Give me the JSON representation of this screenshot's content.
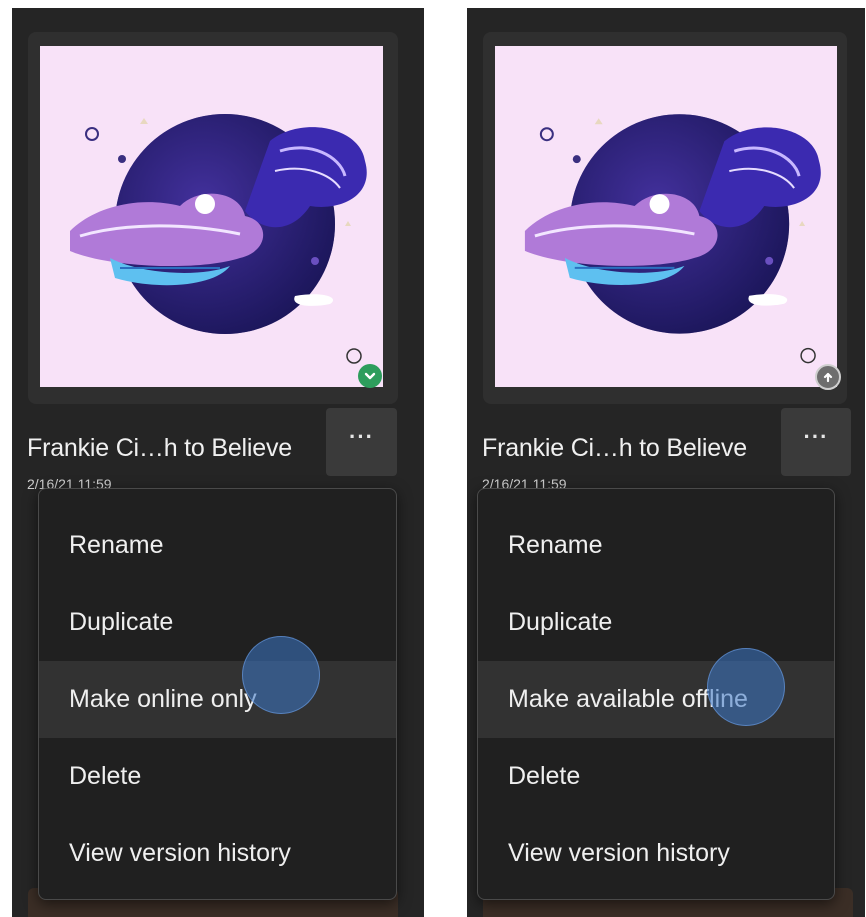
{
  "panels": [
    {
      "file_name": "Frankie Ci…h to Believe",
      "file_date": "2/16/21 11:59",
      "more_label": "···",
      "sync_status": "synced-check",
      "menu": [
        "Rename",
        "Duplicate",
        "Make online only",
        "Delete",
        "View version history"
      ],
      "hovered_item": "Make online only"
    },
    {
      "file_name": "Frankie Ci…h to Believe",
      "file_date": "2/16/21 11:59",
      "more_label": "···",
      "sync_status": "cloud-upload",
      "menu": [
        "Rename",
        "Duplicate",
        "Make available offline",
        "Delete",
        "View version history"
      ],
      "hovered_item": "Make available offline"
    }
  ],
  "colors": {
    "panel_bg": "#252525",
    "menu_bg": "#202020",
    "artwork_bg": "#f8e2f8",
    "synced_badge": "#2d9d5c",
    "touch_indicator": "#3c78c8"
  }
}
